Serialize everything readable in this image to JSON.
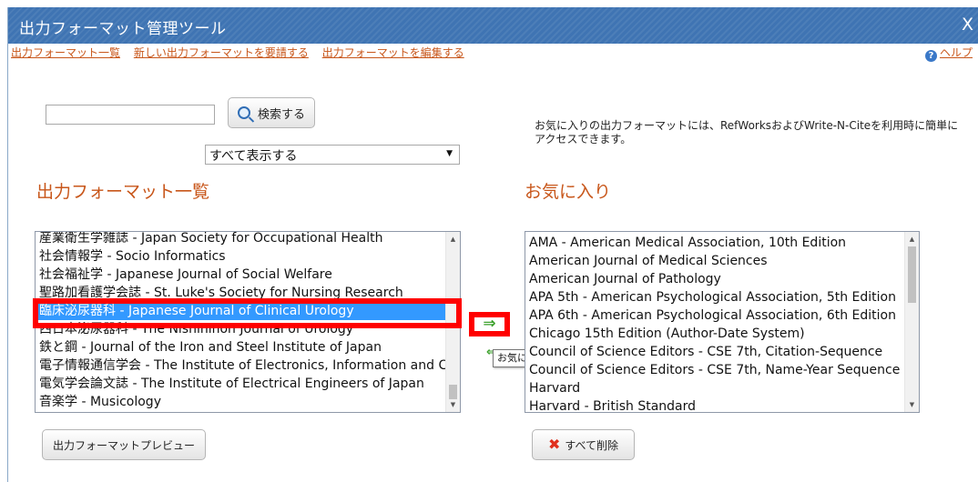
{
  "window": {
    "title": "出力フォーマット管理ツール",
    "close": "X"
  },
  "nav": {
    "links": [
      "出力フォーマット一覧",
      "新しい出力フォーマットを要請する",
      "出力フォーマットを編集する"
    ],
    "help": "ヘルプ",
    "help_icon": "?"
  },
  "search": {
    "value": "",
    "button": "検索する"
  },
  "filter": {
    "selected": "すべて表示する"
  },
  "note": "お気に入りの出力フォーマットには、RefWorksおよびWrite-N-Citeを利用時に簡単にアクセスできます。",
  "left_panel": {
    "heading": "出力フォーマット一覧",
    "items": [
      "産業衛生学雑誌 - Japan Society for Occupational Health",
      "社会情報学 - Socio Informatics",
      "社会福祉学 - Japanese Journal of Social Welfare",
      "聖路加看護学会誌 - St. Luke's Society for Nursing Research",
      "臨床泌尿器科 - Japanese Journal of Clinical Urology",
      "西日本泌尿器科 - The Nishinihon Journal of Urology",
      "鉄と鋼 - Journal of the Iron and Steel Institute of Japan",
      "電子情報通信学会 - The Institute of Electronics, Information and Communication Engineers",
      "電気学会論文誌 - The Institute of Electrical Engineers of Japan",
      "音楽学 - Musicology"
    ],
    "selected_index": 4,
    "preview_button": "出力フォーマットプレビュー"
  },
  "add_button": {
    "arrow": "⇒",
    "tooltip": "お気に入りへ追加"
  },
  "right_panel": {
    "heading": "お気に入り",
    "items": [
      "AMA - American Medical Association, 10th Edition",
      "American Journal of Medical Sciences",
      "American Journal of Pathology",
      "APA 5th - American Psychological Association, 5th Edition",
      "APA 6th - American Psychological Association, 6th Edition",
      "Chicago 15th Edition (Author-Date System)",
      "Council of Science Editors - CSE 7th, Citation-Sequence",
      "Council of Science Editors - CSE 7th, Name-Year Sequence",
      "Harvard",
      "Harvard - British Standard"
    ],
    "delete_button": "すべて削除"
  },
  "colors": {
    "titlebar": "#3f74b3",
    "link": "#c8561a",
    "selection": "#3399ff",
    "highlight": "#ff0000"
  }
}
